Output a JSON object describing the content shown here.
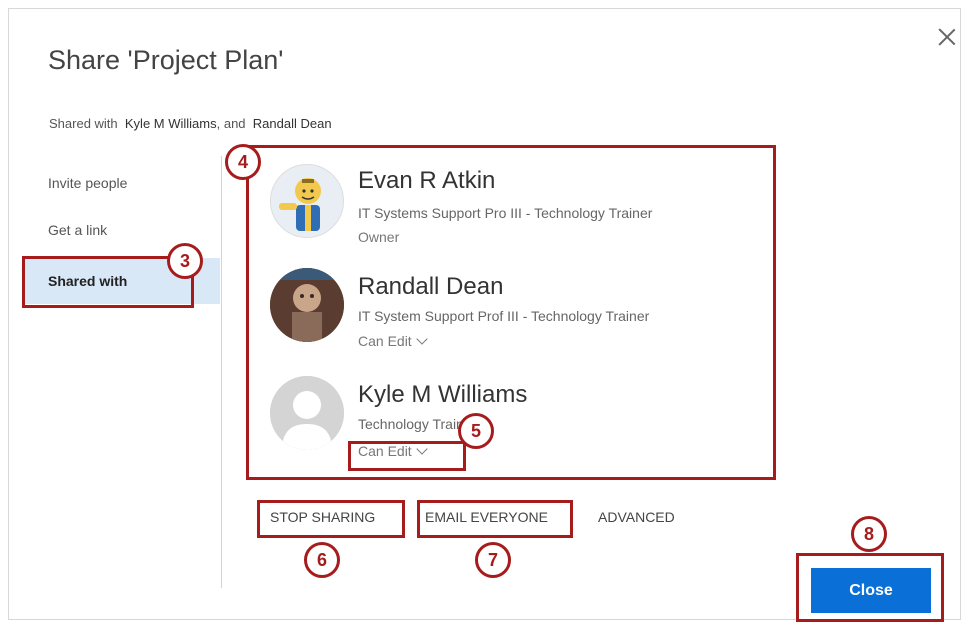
{
  "dialog": {
    "title": "Share 'Project Plan'",
    "shared_with_prefix": "Shared with",
    "shared_with_name1": "Kyle M Williams",
    "shared_with_sep": ", and",
    "shared_with_name2": "Randall Dean"
  },
  "nav": {
    "items": [
      {
        "label": "Invite people"
      },
      {
        "label": "Get a link"
      },
      {
        "label": "Shared with",
        "active": true
      }
    ]
  },
  "people": [
    {
      "name": "Evan R Atkin",
      "role": "IT Systems Support Pro III - Technology Trainer",
      "permission": "Owner"
    },
    {
      "name": "Randall Dean",
      "role": "IT System Support Prof III - Technology Trainer",
      "permission": "Can Edit"
    },
    {
      "name": "Kyle M Williams",
      "role": "Technology Trainer",
      "permission": "Can Edit"
    }
  ],
  "actions": {
    "stop_sharing": "STOP SHARING",
    "email_everyone": "EMAIL EVERYONE",
    "advanced": "ADVANCED"
  },
  "buttons": {
    "close": "Close"
  },
  "callouts": [
    "3",
    "4",
    "5",
    "6",
    "7",
    "8"
  ],
  "colors": {
    "accent": "#0a6fd6",
    "annotation": "#a61c1c",
    "nav_active_bg": "#d8e8f7"
  }
}
